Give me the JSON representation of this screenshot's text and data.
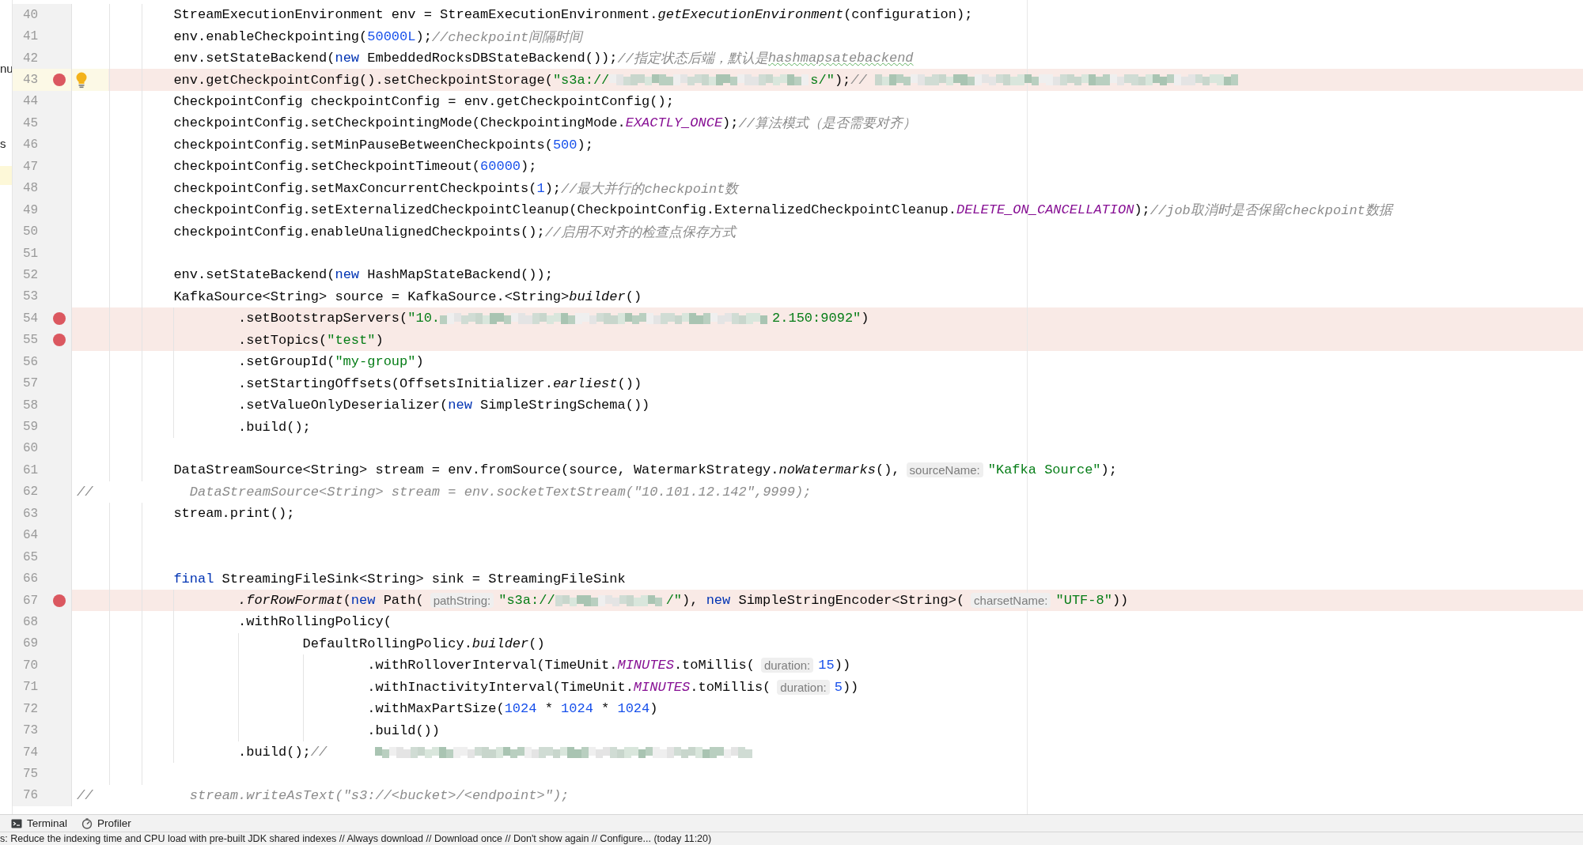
{
  "side_panel": {
    "fragments": [
      "nu",
      "s"
    ]
  },
  "lines": [
    {
      "number": "40",
      "breakpoint": false,
      "current": false,
      "bulb": false,
      "tokens": [
        {
          "kind": "plain",
          "text": "            StreamExecutionEnvironment env = StreamExecutionEnvironment."
        },
        {
          "kind": "italic",
          "text": "getExecutionEnvironment"
        },
        {
          "kind": "plain",
          "text": "(configuration);"
        }
      ]
    },
    {
      "number": "41",
      "breakpoint": false,
      "current": false,
      "bulb": false,
      "tokens": [
        {
          "kind": "plain",
          "text": "            env.enableCheckpointing("
        },
        {
          "kind": "number",
          "text": "50000L"
        },
        {
          "kind": "plain",
          "text": ");"
        },
        {
          "kind": "comment",
          "text": "//checkpoint间隔时间"
        }
      ]
    },
    {
      "number": "42",
      "breakpoint": false,
      "current": false,
      "bulb": false,
      "tokens": [
        {
          "kind": "plain",
          "text": "            env.setStateBackend("
        },
        {
          "kind": "keyword",
          "text": "new"
        },
        {
          "kind": "plain",
          "text": " EmbeddedRocksDBStateBackend());"
        },
        {
          "kind": "comment",
          "text": "//指定状态后端，默认是"
        },
        {
          "kind": "typo",
          "text": "hashmapsatebackend"
        }
      ]
    },
    {
      "number": "43",
      "breakpoint": true,
      "current": true,
      "bulb": true,
      "tokens": [
        {
          "kind": "plain",
          "text": "            env.getCheckpointConfig().setCheckpointStorage("
        },
        {
          "kind": "string",
          "text": "\"s3a://"
        },
        {
          "kind": "redacted"
        },
        {
          "kind": "string",
          "text": "s/\""
        },
        {
          "kind": "plain",
          "text": ");"
        },
        {
          "kind": "comment",
          "text": "// "
        },
        {
          "kind": "redacted"
        }
      ]
    },
    {
      "number": "44",
      "breakpoint": false,
      "current": false,
      "bulb": false,
      "tokens": [
        {
          "kind": "plain",
          "text": "            CheckpointConfig checkpointConfig = env.getCheckpointConfig();"
        }
      ]
    },
    {
      "number": "45",
      "breakpoint": false,
      "current": false,
      "bulb": false,
      "tokens": [
        {
          "kind": "plain",
          "text": "            checkpointConfig.setCheckpointingMode(CheckpointingMode."
        },
        {
          "kind": "constant",
          "text": "EXACTLY_ONCE"
        },
        {
          "kind": "plain",
          "text": ");"
        },
        {
          "kind": "comment",
          "text": "//算法模式（是否需要对齐）"
        }
      ]
    },
    {
      "number": "46",
      "breakpoint": false,
      "current": false,
      "bulb": false,
      "tokens": [
        {
          "kind": "plain",
          "text": "            checkpointConfig.setMinPauseBetweenCheckpoints("
        },
        {
          "kind": "number",
          "text": "500"
        },
        {
          "kind": "plain",
          "text": ");"
        }
      ]
    },
    {
      "number": "47",
      "breakpoint": false,
      "current": false,
      "bulb": false,
      "tokens": [
        {
          "kind": "plain",
          "text": "            checkpointConfig.setCheckpointTimeout("
        },
        {
          "kind": "number",
          "text": "60000"
        },
        {
          "kind": "plain",
          "text": ");"
        }
      ]
    },
    {
      "number": "48",
      "breakpoint": false,
      "current": false,
      "bulb": false,
      "tokens": [
        {
          "kind": "plain",
          "text": "            checkpointConfig.setMaxConcurrentCheckpoints("
        },
        {
          "kind": "number",
          "text": "1"
        },
        {
          "kind": "plain",
          "text": ");"
        },
        {
          "kind": "comment",
          "text": "//最大并行的checkpoint数"
        }
      ]
    },
    {
      "number": "49",
      "breakpoint": false,
      "current": false,
      "bulb": false,
      "tokens": [
        {
          "kind": "plain",
          "text": "            checkpointConfig.setExternalizedCheckpointCleanup(CheckpointConfig.ExternalizedCheckpointCleanup."
        },
        {
          "kind": "constant",
          "text": "DELETE_ON_CANCELLATION"
        },
        {
          "kind": "plain",
          "text": ");"
        },
        {
          "kind": "comment",
          "text": "//job取消时是否保留checkpoint数据"
        }
      ]
    },
    {
      "number": "50",
      "breakpoint": false,
      "current": false,
      "bulb": false,
      "tokens": [
        {
          "kind": "plain",
          "text": "            checkpointConfig.enableUnalignedCheckpoints();"
        },
        {
          "kind": "comment",
          "text": "//启用不对齐的检查点保存方式"
        }
      ]
    },
    {
      "number": "51",
      "breakpoint": false,
      "current": false,
      "bulb": false
    },
    {
      "number": "52",
      "breakpoint": false,
      "current": false,
      "bulb": false,
      "tokens": [
        {
          "kind": "plain",
          "text": "            env.setStateBackend("
        },
        {
          "kind": "keyword",
          "text": "new"
        },
        {
          "kind": "plain",
          "text": " HashMapStateBackend());"
        }
      ]
    },
    {
      "number": "53",
      "breakpoint": false,
      "current": false,
      "bulb": false,
      "tokens": [
        {
          "kind": "plain",
          "text": "            KafkaSource<String> source = KafkaSource.<String>"
        },
        {
          "kind": "italic",
          "text": "builder"
        },
        {
          "kind": "plain",
          "text": "()"
        }
      ]
    },
    {
      "number": "54",
      "breakpoint": true,
      "current": false,
      "bulb": false,
      "tokens": [
        {
          "kind": "plain",
          "text": "                    .setBootstrapServers("
        },
        {
          "kind": "string",
          "text": "\"10."
        },
        {
          "kind": "redacted"
        },
        {
          "kind": "string",
          "text": "2.150:9092\""
        },
        {
          "kind": "plain",
          "text": ")"
        }
      ]
    },
    {
      "number": "55",
      "breakpoint": true,
      "current": false,
      "bulb": false,
      "tokens": [
        {
          "kind": "plain",
          "text": "                    .setTopics("
        },
        {
          "kind": "string",
          "text": "\"test\""
        },
        {
          "kind": "plain",
          "text": ")"
        }
      ]
    },
    {
      "number": "56",
      "breakpoint": false,
      "current": false,
      "bulb": false,
      "tokens": [
        {
          "kind": "plain",
          "text": "                    .setGroupId("
        },
        {
          "kind": "string",
          "text": "\"my-group\""
        },
        {
          "kind": "plain",
          "text": ")"
        }
      ]
    },
    {
      "number": "57",
      "breakpoint": false,
      "current": false,
      "bulb": false,
      "tokens": [
        {
          "kind": "plain",
          "text": "                    .setStartingOffsets(OffsetsInitializer."
        },
        {
          "kind": "italic",
          "text": "earliest"
        },
        {
          "kind": "plain",
          "text": "())"
        }
      ]
    },
    {
      "number": "58",
      "breakpoint": false,
      "current": false,
      "bulb": false,
      "tokens": [
        {
          "kind": "plain",
          "text": "                    .setValueOnlyDeserializer("
        },
        {
          "kind": "keyword",
          "text": "new"
        },
        {
          "kind": "plain",
          "text": " SimpleStringSchema())"
        }
      ]
    },
    {
      "number": "59",
      "breakpoint": false,
      "current": false,
      "bulb": false,
      "tokens": [
        {
          "kind": "plain",
          "text": "                    .build();"
        }
      ]
    },
    {
      "number": "60",
      "breakpoint": false,
      "current": false,
      "bulb": false
    },
    {
      "number": "61",
      "breakpoint": false,
      "current": false,
      "bulb": false,
      "tokens": [
        {
          "kind": "plain",
          "text": "            DataStreamSource<String> stream = env.fromSource(source, WatermarkStrategy."
        },
        {
          "kind": "italic",
          "text": "noWatermarks"
        },
        {
          "kind": "plain",
          "text": "(),"
        },
        {
          "kind": "hint",
          "text": "sourceName:"
        },
        {
          "kind": "string",
          "text": "\"Kafka Source\""
        },
        {
          "kind": "plain",
          "text": ");"
        }
      ]
    },
    {
      "number": "62",
      "breakpoint": false,
      "current": false,
      "bulb": false,
      "tokens": [
        {
          "kind": "comment",
          "text": "//            DataStreamSource<String> stream = env.socketTextStream(\"10.101.12.142\",9999);"
        }
      ]
    },
    {
      "number": "63",
      "breakpoint": false,
      "current": false,
      "bulb": false,
      "tokens": [
        {
          "kind": "plain",
          "text": "            stream.print();"
        }
      ]
    },
    {
      "number": "64",
      "breakpoint": false,
      "current": false,
      "bulb": false
    },
    {
      "number": "65",
      "breakpoint": false,
      "current": false,
      "bulb": false
    },
    {
      "number": "66",
      "breakpoint": false,
      "current": false,
      "bulb": false,
      "tokens": [
        {
          "kind": "keyword",
          "text": "            final"
        },
        {
          "kind": "plain",
          "text": " StreamingFileSink<String> sink = StreamingFileSink"
        }
      ]
    },
    {
      "number": "67",
      "breakpoint": true,
      "current": false,
      "bulb": false,
      "tokens": [
        {
          "kind": "italic",
          "text": "                    .forRowFormat"
        },
        {
          "kind": "plain",
          "text": "("
        },
        {
          "kind": "keyword",
          "text": "new"
        },
        {
          "kind": "plain",
          "text": " Path("
        },
        {
          "kind": "hint",
          "text": "pathString:"
        },
        {
          "kind": "string",
          "text": "\"s3a://"
        },
        {
          "kind": "redacted"
        },
        {
          "kind": "string",
          "text": "/\""
        },
        {
          "kind": "plain",
          "text": "), "
        },
        {
          "kind": "keyword",
          "text": "new"
        },
        {
          "kind": "plain",
          "text": " SimpleStringEncoder<String>("
        },
        {
          "kind": "hint",
          "text": "charsetName:"
        },
        {
          "kind": "string",
          "text": "\"UTF-8\""
        },
        {
          "kind": "plain",
          "text": "))"
        }
      ]
    },
    {
      "number": "68",
      "breakpoint": false,
      "current": false,
      "bulb": false,
      "tokens": [
        {
          "kind": "plain",
          "text": "                    .withRollingPolicy("
        }
      ]
    },
    {
      "number": "69",
      "breakpoint": false,
      "current": false,
      "bulb": false,
      "tokens": [
        {
          "kind": "plain",
          "text": "                            DefaultRollingPolicy."
        },
        {
          "kind": "italic",
          "text": "builder"
        },
        {
          "kind": "plain",
          "text": "()"
        }
      ]
    },
    {
      "number": "70",
      "breakpoint": false,
      "current": false,
      "bulb": false,
      "tokens": [
        {
          "kind": "plain",
          "text": "                                    .withRolloverInterval(TimeUnit."
        },
        {
          "kind": "constant",
          "text": "MINUTES"
        },
        {
          "kind": "plain",
          "text": ".toMillis("
        },
        {
          "kind": "hint",
          "text": "duration:"
        },
        {
          "kind": "number",
          "text": "15"
        },
        {
          "kind": "plain",
          "text": "))"
        }
      ]
    },
    {
      "number": "71",
      "breakpoint": false,
      "current": false,
      "bulb": false,
      "tokens": [
        {
          "kind": "plain",
          "text": "                                    .withInactivityInterval(TimeUnit."
        },
        {
          "kind": "constant",
          "text": "MINUTES"
        },
        {
          "kind": "plain",
          "text": ".toMillis("
        },
        {
          "kind": "hint",
          "text": "duration:"
        },
        {
          "kind": "number",
          "text": "5"
        },
        {
          "kind": "plain",
          "text": "))"
        }
      ]
    },
    {
      "number": "72",
      "breakpoint": false,
      "current": false,
      "bulb": false,
      "tokens": [
        {
          "kind": "plain",
          "text": "                                    .withMaxPartSize("
        },
        {
          "kind": "number",
          "text": "1024"
        },
        {
          "kind": "plain",
          "text": " * "
        },
        {
          "kind": "number",
          "text": "1024"
        },
        {
          "kind": "plain",
          "text": " * "
        },
        {
          "kind": "number",
          "text": "1024"
        },
        {
          "kind": "plain",
          "text": ")"
        }
      ]
    },
    {
      "number": "73",
      "breakpoint": false,
      "current": false,
      "bulb": false,
      "tokens": [
        {
          "kind": "plain",
          "text": "                                    .build())"
        }
      ]
    },
    {
      "number": "74",
      "breakpoint": false,
      "current": false,
      "bulb": false,
      "tokens": [
        {
          "kind": "plain",
          "text": "                    .build();"
        },
        {
          "kind": "comment",
          "text": "//      "
        },
        {
          "kind": "redacted"
        }
      ]
    },
    {
      "number": "75",
      "breakpoint": false,
      "current": false,
      "bulb": false
    },
    {
      "number": "76",
      "breakpoint": false,
      "current": false,
      "bulb": false,
      "tokens": [
        {
          "kind": "comment",
          "text": "//            stream.writeAsText(\"s3://<bucket>/<endpoint>\");"
        }
      ]
    }
  ],
  "tool_tabs": [
    {
      "kind": "terminal",
      "label": "Terminal"
    },
    {
      "kind": "profiler",
      "label": "Profiler"
    }
  ],
  "status_bar": {
    "text": "s: Reduce the indexing time and CPU load with pre-built JDK shared indexes // Always download // Download once // Don't show again // Configure... (today 11:20)"
  }
}
